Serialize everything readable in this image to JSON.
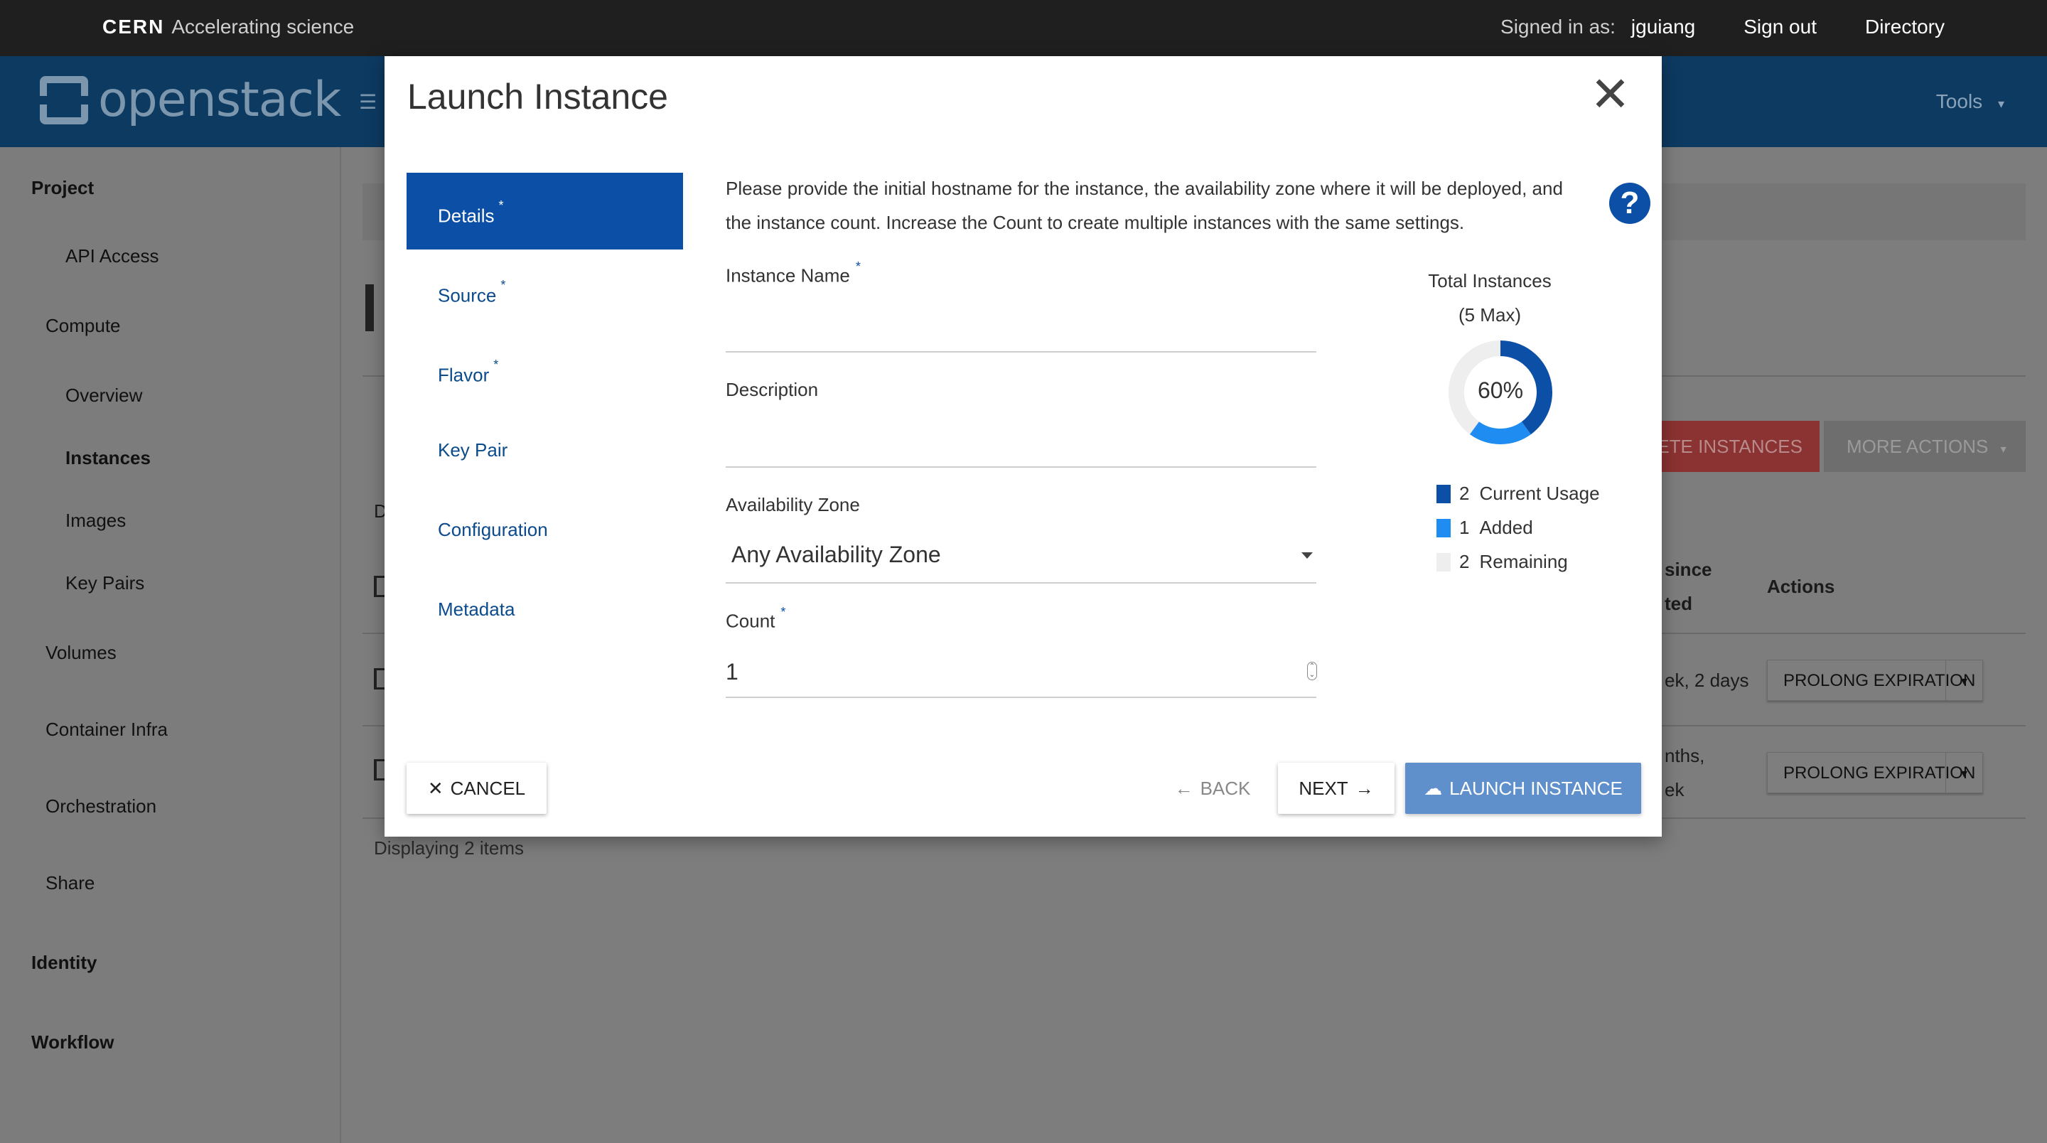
{
  "cern_bar": {
    "brand_bold": "CERN",
    "brand_tagline": "Accelerating science",
    "signed_in_label": "Signed in as:",
    "username": "jguiang",
    "sign_out": "Sign out",
    "directory": "Directory"
  },
  "header": {
    "logo_text": "openstack",
    "tools_label": "Tools"
  },
  "sidebar": {
    "project": "Project",
    "api_access": "API Access",
    "compute": "Compute",
    "overview": "Overview",
    "instances": "Instances",
    "images": "Images",
    "key_pairs": "Key Pairs",
    "volumes": "Volumes",
    "container_infra": "Container Infra",
    "orchestration": "Orchestration",
    "share": "Share",
    "identity": "Identity",
    "workflow": "Workflow"
  },
  "background": {
    "delete_btn_fragment": "ETE INSTANCES",
    "more_actions": "MORE ACTIONS",
    "col_since_line1": "since",
    "col_since_line2": "ted",
    "col_actions": "Actions",
    "row1_age": "ek, 2 days",
    "row2_age_line1": "nths,",
    "row2_age_line2": "ek",
    "prolong_label": "PROLONG EXPIRATION",
    "displaying": "Displaying 2 items",
    "d_fragment": "D"
  },
  "modal": {
    "title": "Launch Instance",
    "steps": [
      {
        "label": "Details",
        "required": "*"
      },
      {
        "label": "Source",
        "required": "*"
      },
      {
        "label": "Flavor",
        "required": "*"
      },
      {
        "label": "Key Pair",
        "required": ""
      },
      {
        "label": "Configuration",
        "required": ""
      },
      {
        "label": "Metadata",
        "required": ""
      }
    ],
    "help_text": "Please provide the initial hostname for the instance, the availability zone where it will be deployed, and the instance count. Increase the Count to create multiple instances with the same settings.",
    "instance_name_label": "Instance Name",
    "instance_name_value": "",
    "description_label": "Description",
    "description_value": "",
    "availability_zone_label": "Availability Zone",
    "availability_zone_value": "Any Availability Zone",
    "count_label": "Count",
    "count_value": "1",
    "required_marker": "*",
    "total_title_line1": "Total Instances",
    "total_title_line2": "(5 Max)",
    "usage_percent": "60%",
    "legend": [
      {
        "count": "2",
        "label": "Current Usage",
        "color": "#0b4fa6"
      },
      {
        "count": "1",
        "label": "Added",
        "color": "#1e8cf0"
      },
      {
        "count": "2",
        "label": "Remaining",
        "color": "#eeeeee"
      }
    ],
    "buttons": {
      "cancel": "CANCEL",
      "back": "BACK",
      "next": "NEXT",
      "launch": "LAUNCH INSTANCE"
    }
  },
  "colors": {
    "primary": "#0b4fa6",
    "added": "#1e8cf0",
    "launch_button": "#5f90cb"
  }
}
